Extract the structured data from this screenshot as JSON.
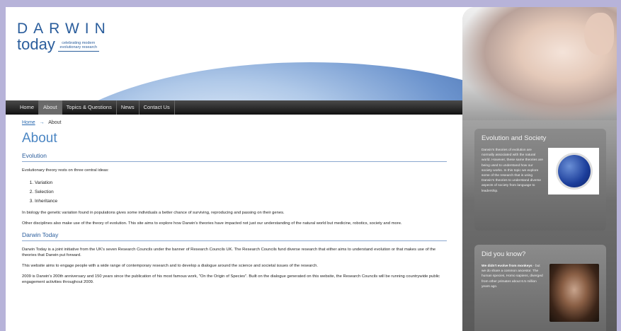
{
  "logo": {
    "word_top": "DARWIN",
    "word_bottom": "today",
    "tagline": "celebrating modern evolutionary research"
  },
  "nav": {
    "items": [
      {
        "label": "Home",
        "active": false
      },
      {
        "label": "About",
        "active": true
      },
      {
        "label": "Topics & Questions",
        "active": false
      },
      {
        "label": "News",
        "active": false
      },
      {
        "label": "Contact Us",
        "active": false
      }
    ]
  },
  "breadcrumb": {
    "home": "Home",
    "separator": "→",
    "current": "About"
  },
  "page_title": "About",
  "evolution": {
    "heading": "Evolution",
    "intro": "Evolutionary theory rests on three central ideas:",
    "ideas": [
      "Variation",
      "Selection",
      "Inheritance"
    ],
    "para1": "In biology the genetic variation found in populations gives some individuals a better chance of surviving, reproducing and passing on their genes.",
    "para2": "Other disciplines also make use of the theory of evolution. This site aims to explore how Darwin's theories have impacted not just our understanding of the natural world but medicine, robotics, society and more."
  },
  "darwin_today": {
    "heading": "Darwin Today",
    "para1": "Darwin Today is a joint initiative from the UK's seven Research Councils under the banner of Research Councils UK. The Research Councils fund diverse research that either aims to understand evolution or that makes use of the theories that Darwin put forward.",
    "para2": "This website aims to engage people with a wide range of contemporary research and to develop a dialogue around the science and societal issues of the research.",
    "para3": "2009 is Darwin's 200th anniversary and 150 years since the publication of his most famous work, \"On the Origin of Species\". Built on the dialogue generated on this website, the Research Councils will be running countrywide public engagement activities throughout 2009."
  },
  "sidebar": {
    "evolution_society": {
      "title": "Evolution and Society",
      "text": "Darwin's theories of evolution are normally associated with the natural world. However, these same theories are being used to understand how our society works. In this topic we explore some of the research that is using Darwin's theories to understand diverse aspects of society from language to leadership."
    },
    "did_you_know": {
      "title": "Did you know?",
      "bold": "We didn't evolve from monkeys",
      "text": " - but we do share a common ancestor. The human species, Homo sapiens, diverged from other primates about 6.5 million years ago."
    }
  }
}
